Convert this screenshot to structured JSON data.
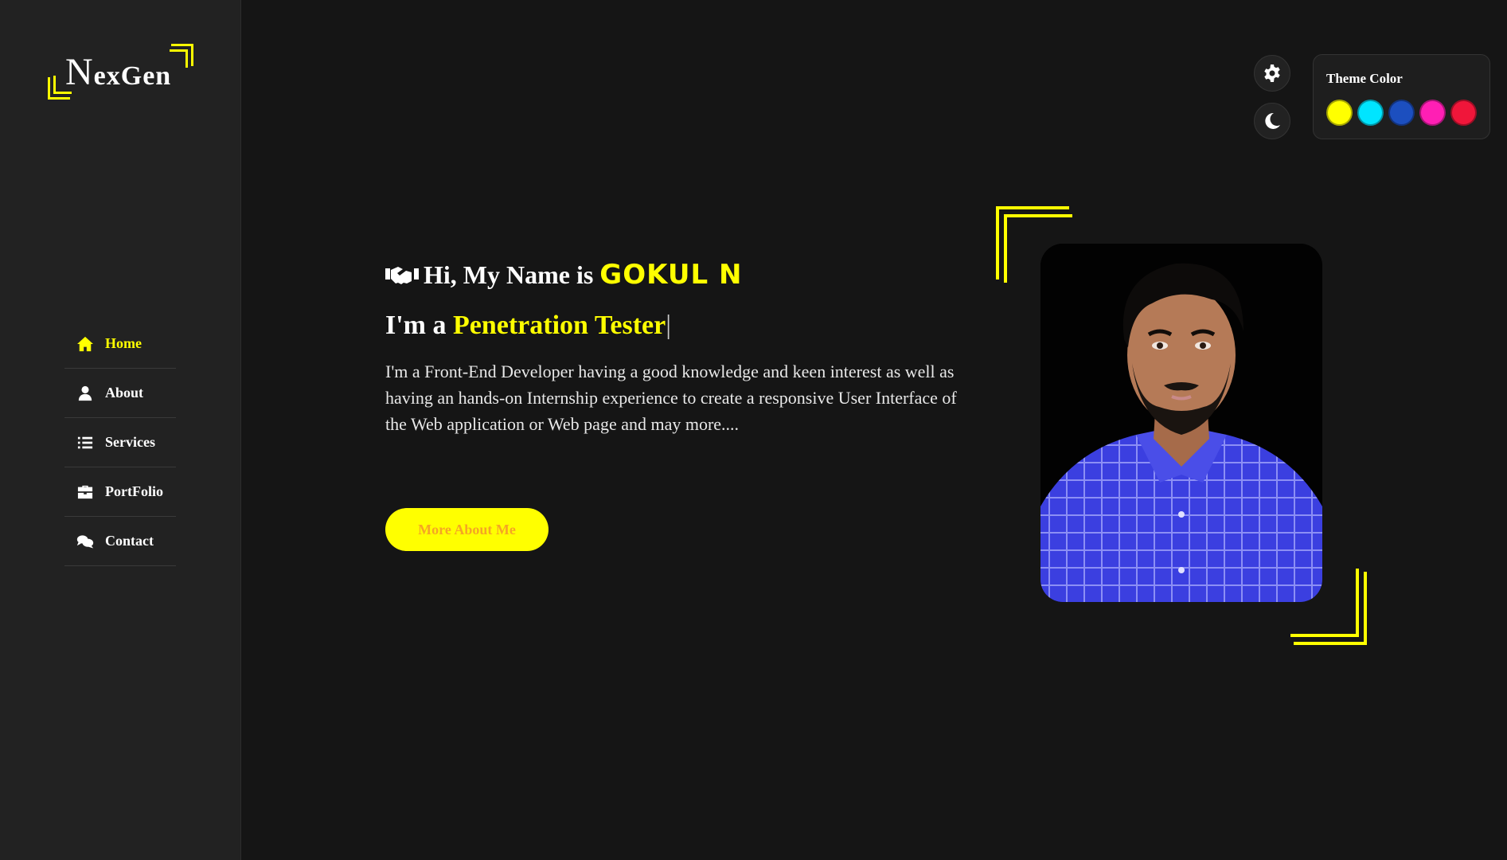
{
  "logo": {
    "initial": "N",
    "rest": "exGen"
  },
  "nav": {
    "items": [
      {
        "label": "Home",
        "icon": "home-icon",
        "active": true
      },
      {
        "label": "About",
        "icon": "user-icon",
        "active": false
      },
      {
        "label": "Services",
        "icon": "list-icon",
        "active": false
      },
      {
        "label": "PortFolio",
        "icon": "briefcase-icon",
        "active": false
      },
      {
        "label": "Contact",
        "icon": "comments-icon",
        "active": false
      }
    ]
  },
  "controls": {
    "settings_icon": "gear-icon",
    "mode_icon": "moon-icon"
  },
  "theme": {
    "title": "Theme Color",
    "colors": [
      "#ffff00",
      "#00e5ff",
      "#1c4fbf",
      "#ff1fb4",
      "#f0163a"
    ]
  },
  "hero": {
    "greeting_prefix": "Hi, My Name is",
    "name": "GOKUL N",
    "role_prefix": "I'm a",
    "role": "Penetration Tester",
    "cursor": "|",
    "description": "I'm a Front-End Developer having a good knowledge and keen interest as well as having an hands-on Internship experience to create a responsive User Interface of the Web application or Web page and may more....",
    "cta_label": "More About Me"
  },
  "accent_color": "#ffff00"
}
